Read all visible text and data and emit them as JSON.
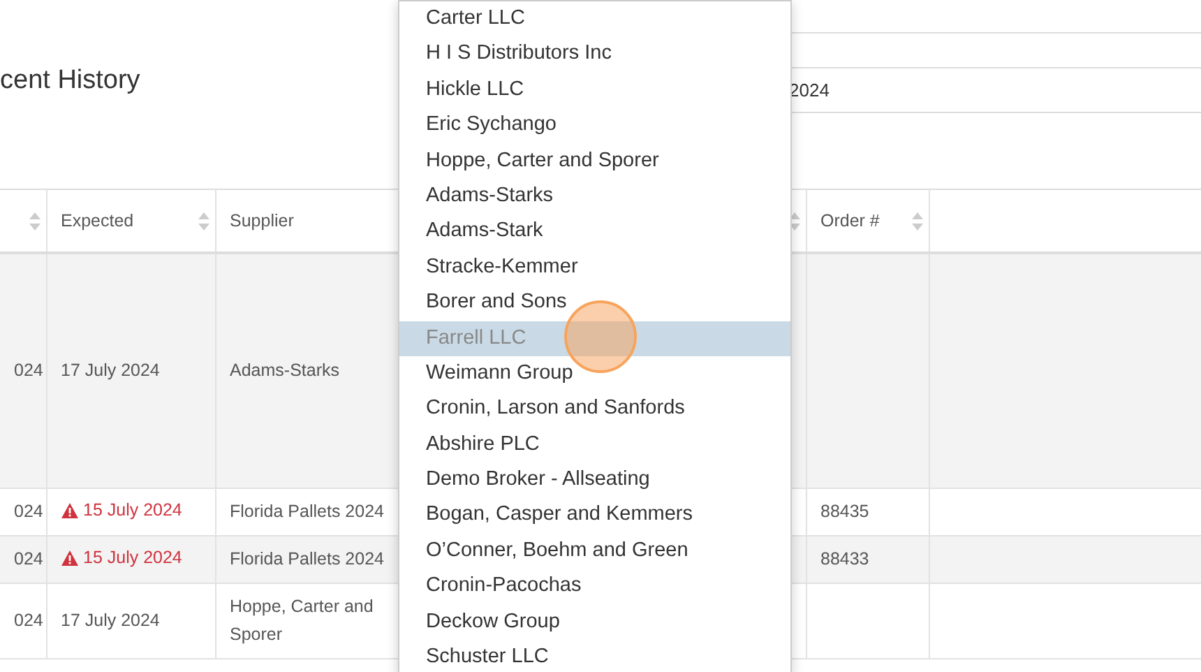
{
  "heading": "cent History",
  "details": [
    {
      "value": "2024"
    }
  ],
  "table": {
    "columns": [
      {
        "sortable": true
      },
      {
        "label": "Expected",
        "sortable": true
      },
      {
        "label": "Supplier",
        "sortable": false
      },
      {
        "sortable": true
      },
      {
        "label": "Order #",
        "sortable": true
      },
      {
        "sortable": false
      }
    ],
    "rows": [
      {
        "column_1": "024",
        "expected": "17 July 2024",
        "overdue": false,
        "supplier": "Adams-Starks"
      },
      {
        "column_1": "024",
        "expected": "15 July 2024",
        "overdue": true,
        "supplier": "Florida Pallets 2024",
        "order": "88435"
      },
      {
        "column_1": "024",
        "expected": "15 July 2024",
        "overdue": true,
        "supplier": "Florida Pallets 2024",
        "order": "88433"
      },
      {
        "column_1": "024",
        "expected": "17 July 2024",
        "overdue": false,
        "supplier": "Hoppe, Carter and Sporer"
      }
    ]
  },
  "dropdown": {
    "items": [
      {
        "label": "Carter LLC",
        "selected": false
      },
      {
        "label": "H I S Distributors Inc",
        "selected": false
      },
      {
        "label": "Hickle LLC",
        "selected": false
      },
      {
        "label": "Eric Sychango",
        "selected": false
      },
      {
        "label": "Hoppe, Carter and Sporer",
        "selected": false
      },
      {
        "label": "Adams-Starks",
        "selected": false
      },
      {
        "label": "Adams-Stark",
        "selected": false
      },
      {
        "label": "Stracke-Kemmer",
        "selected": false
      },
      {
        "label": "Borer and Sons",
        "selected": false
      },
      {
        "label": "Farrell LLC",
        "selected": true
      },
      {
        "label": "Weimann Group",
        "selected": false
      },
      {
        "label": "Cronin, Larson and Sanfords",
        "selected": false
      },
      {
        "label": "Abshire PLC",
        "selected": false
      },
      {
        "label": "Demo Broker -  Allseating",
        "selected": false
      },
      {
        "label": "Bogan, Casper and Kemmers",
        "selected": false
      },
      {
        "label": "O’Conner, Boehm and Green",
        "selected": false
      },
      {
        "label": "Cronin-Pacochas",
        "selected": false
      },
      {
        "label": "Deckow Group",
        "selected": false
      },
      {
        "label": "Schuster LLC",
        "selected": false
      }
    ]
  }
}
